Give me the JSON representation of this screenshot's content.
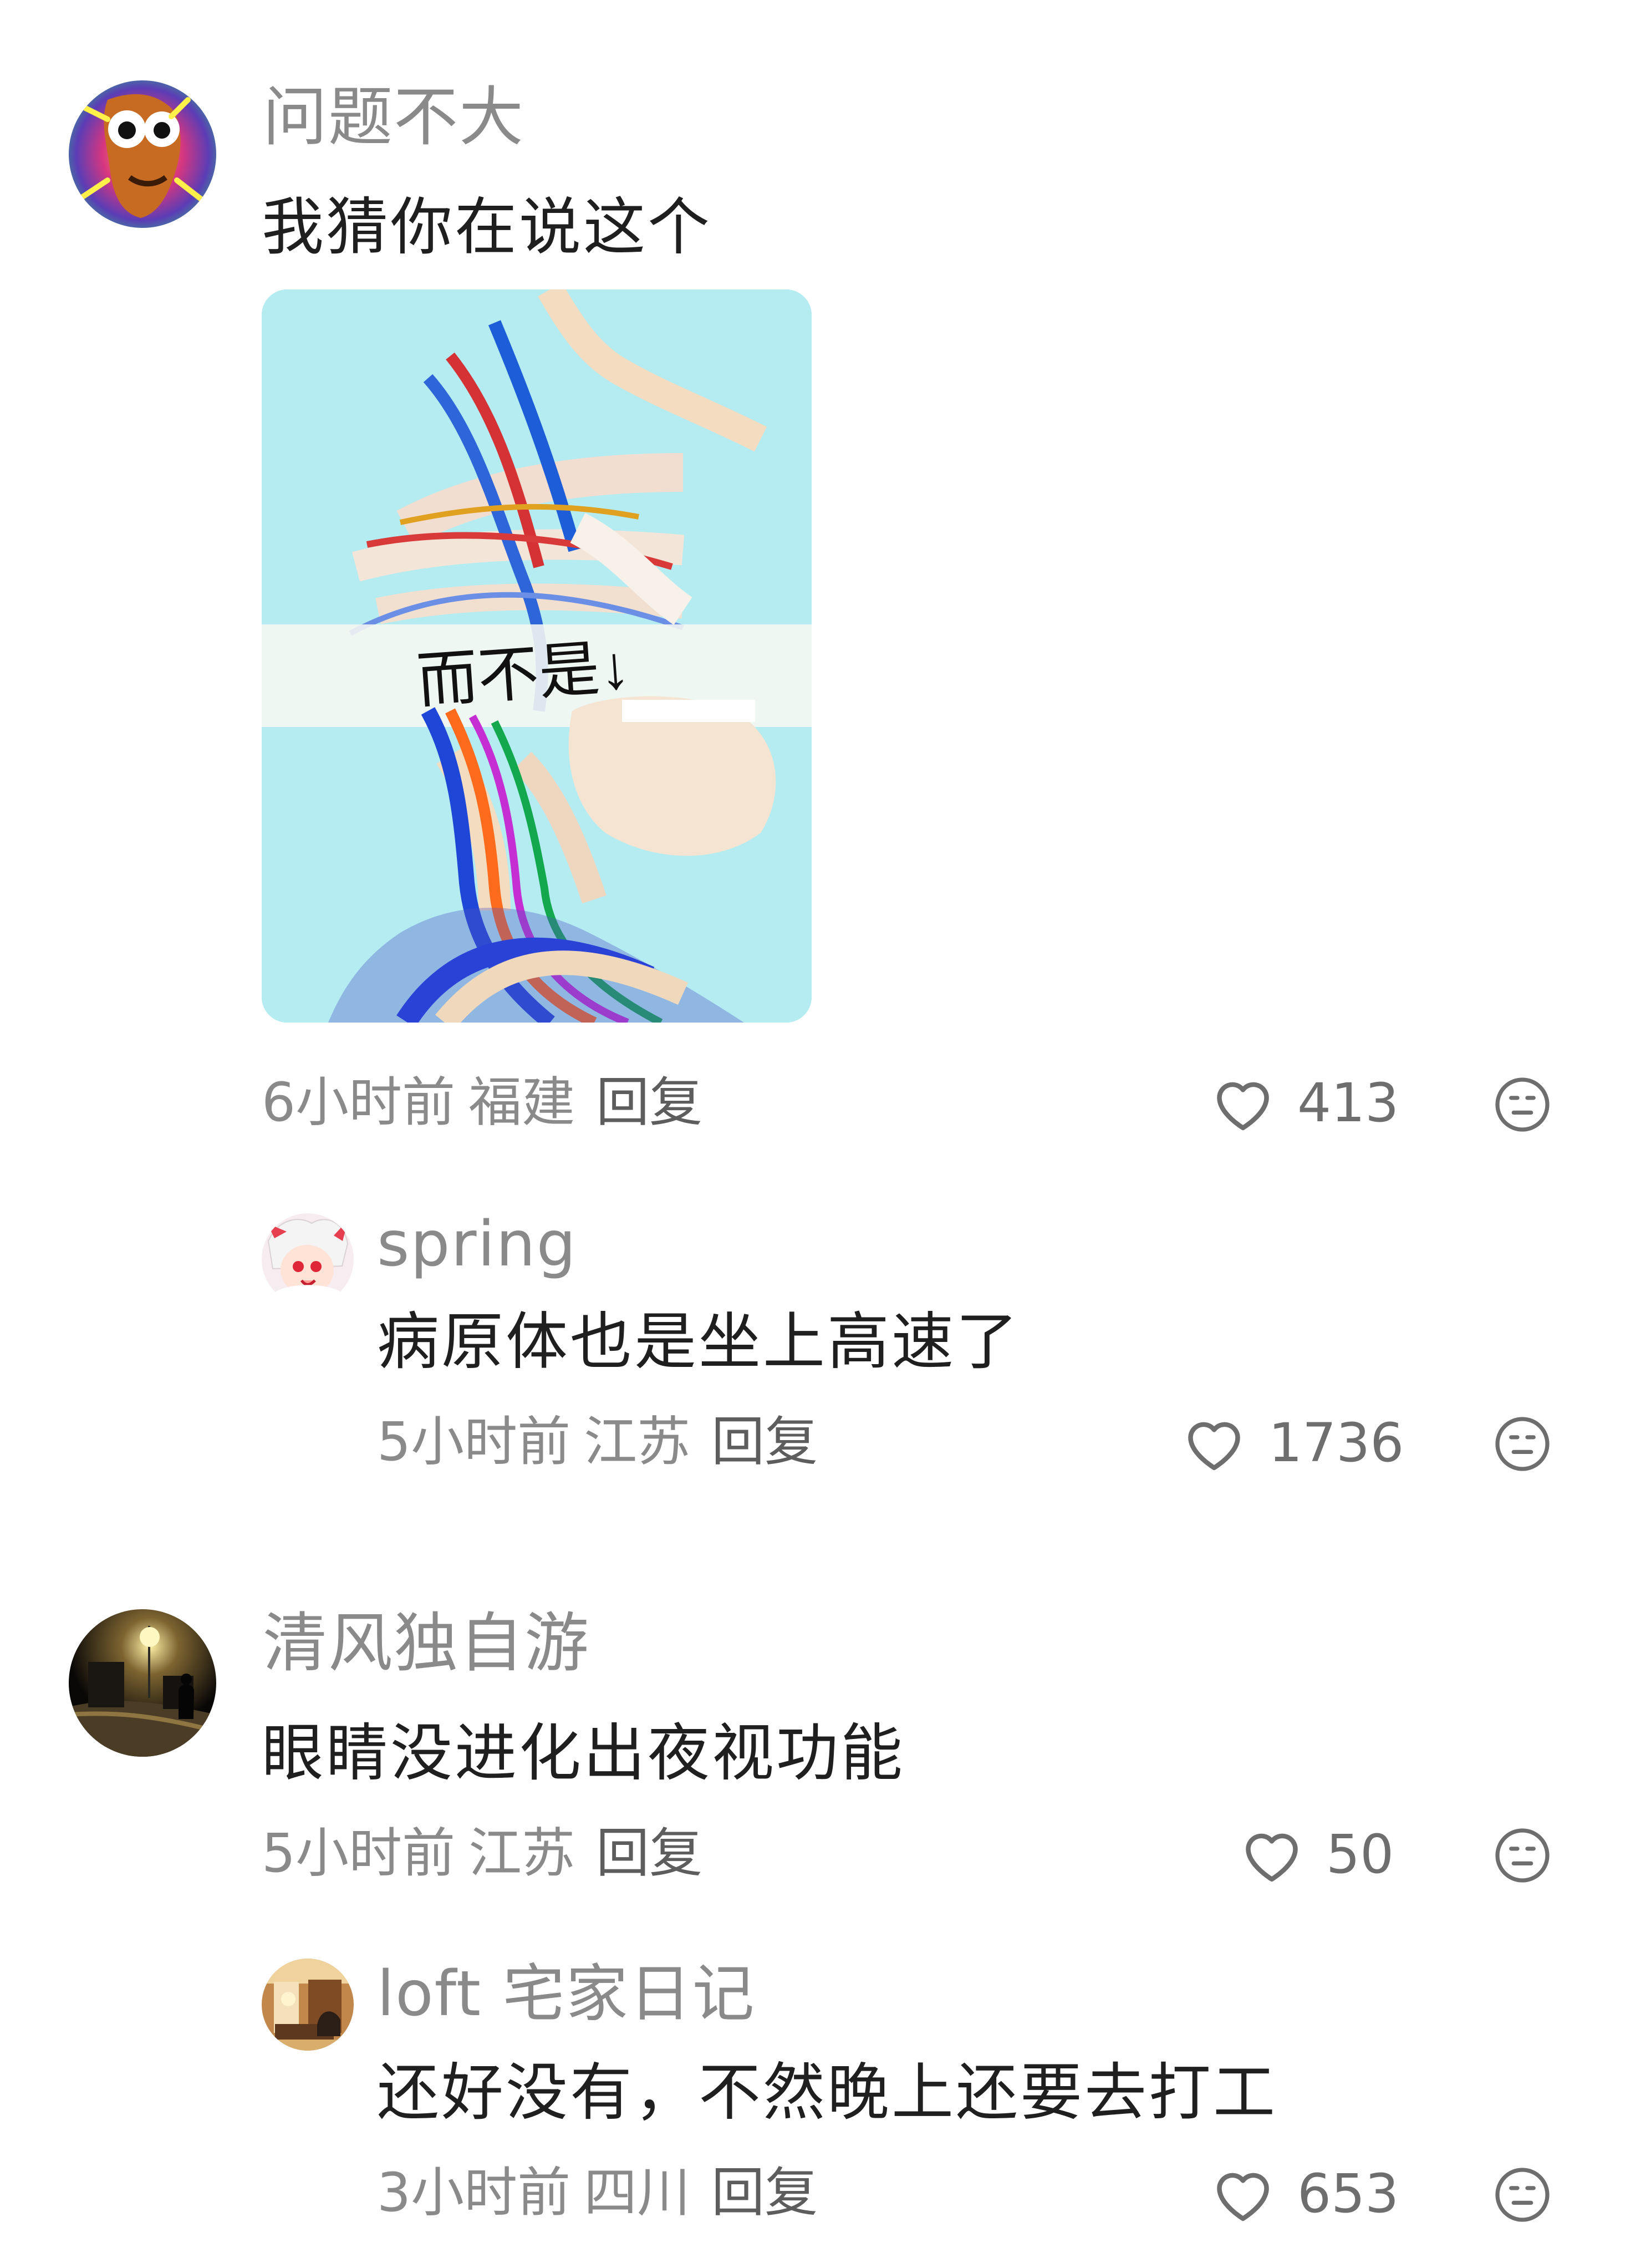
{
  "comments": [
    {
      "username": "问题不大",
      "content": "我猜你在说这个",
      "time": "6小时前",
      "location": "福建",
      "reply_label": "回复",
      "likes": "413",
      "image_overlay_text": "而不是↓",
      "replies": [
        {
          "username": "spring",
          "content": "病原体也是坐上高速了",
          "time": "5小时前",
          "location": "江苏",
          "reply_label": "回复",
          "likes": "1736"
        }
      ]
    },
    {
      "username": "清风独自游",
      "content": "眼睛没进化出夜视功能",
      "time": "5小时前",
      "location": "江苏",
      "reply_label": "回复",
      "likes": "50",
      "replies": [
        {
          "username": "loft 宅家日记",
          "content": "还好没有，不然晚上还要去打工",
          "time": "3小时前",
          "location": "四川",
          "reply_label": "回复",
          "likes": "653"
        }
      ]
    }
  ],
  "icons": {
    "like": "heart-outline-icon",
    "dislike": "neutral-face-icon"
  },
  "colors": {
    "username": "#8a8a8a",
    "content": "#1f1f1f",
    "meta": "#8a8a8a",
    "reply": "#5d5d5d",
    "image_background": "#aeeaf0"
  }
}
